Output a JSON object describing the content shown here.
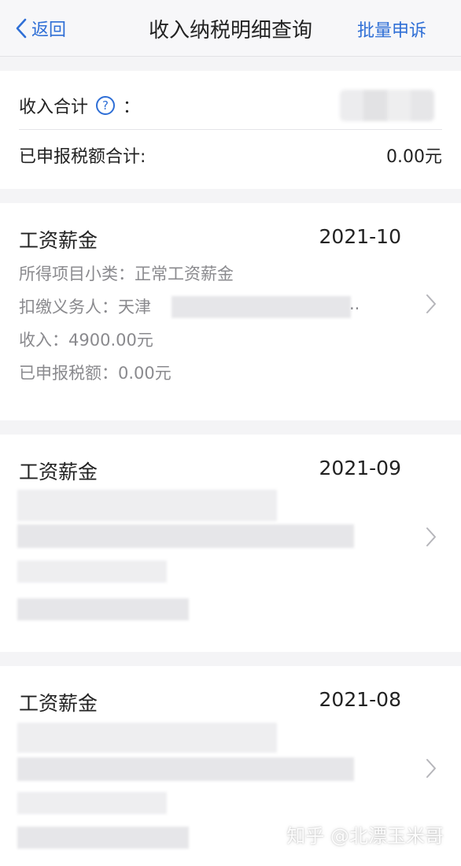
{
  "nav": {
    "back_label": "返回",
    "title": "收入纳税明细查询",
    "right_action": "批量申诉"
  },
  "summary": {
    "income_total_label": "收入合计",
    "colon": "：",
    "tax_total_label": "已申报税额合计:",
    "tax_total_value": "0.00元"
  },
  "records": [
    {
      "category": "工资薪金",
      "period": "2021-10",
      "subcategory_label": "所得项目小类：",
      "subcategory_value": "正常工资薪金",
      "withholder_label": "扣缴义务人：",
      "withholder_value": "天津",
      "withholder_suffix": "..",
      "income_label": "收入：",
      "income_value": "4900.00元",
      "tax_label": "已申报税额：",
      "tax_value": "0.00元"
    },
    {
      "category": "工资薪金",
      "period": "2021-09"
    },
    {
      "category": "工资薪金",
      "period": "2021-08"
    }
  ],
  "watermark": "知乎 @北漂玉米哥",
  "colors": {
    "accent": "#2f6fd6",
    "background": "#f4f4f6",
    "secondary_text": "#8a8a8e"
  }
}
